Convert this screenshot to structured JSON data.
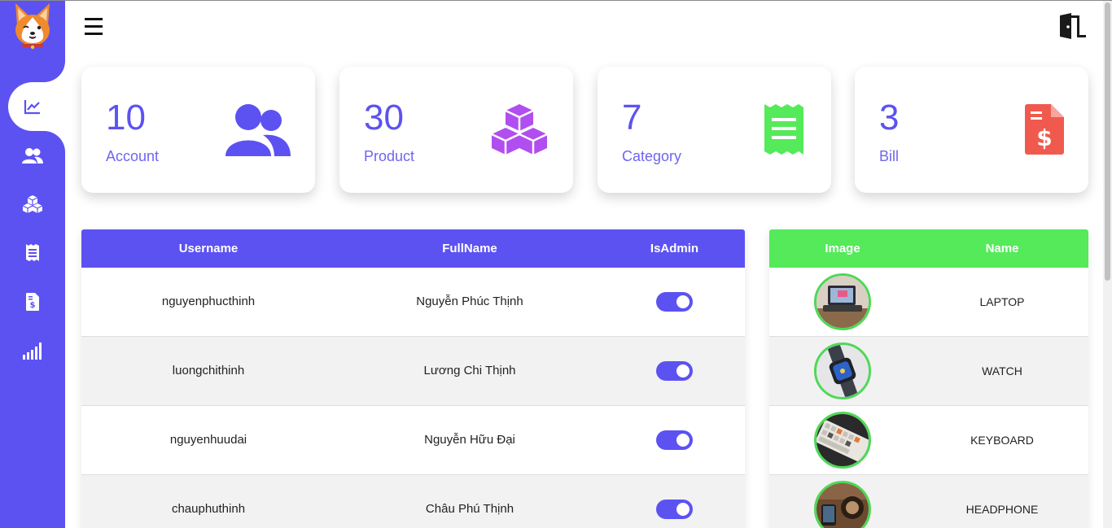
{
  "sidebar": {
    "logo_icon": "corgi-dog-logo",
    "items": [
      {
        "icon": "chart-line-icon",
        "active": true
      },
      {
        "icon": "users-icon",
        "active": false
      },
      {
        "icon": "cubes-icon",
        "active": false
      },
      {
        "icon": "receipt-icon",
        "active": false
      },
      {
        "icon": "invoice-dollar-icon",
        "active": false
      },
      {
        "icon": "signal-bars-icon",
        "active": false
      }
    ]
  },
  "topbar": {
    "menu_icon": "hamburger-menu-icon",
    "logout_icon": "door-exit-icon"
  },
  "stats": [
    {
      "value": "10",
      "label": "Account",
      "icon": "users-icon",
      "color": "#5c52f2"
    },
    {
      "value": "30",
      "label": "Product",
      "icon": "cubes-icon",
      "color": "#b04ef0"
    },
    {
      "value": "7",
      "label": "Category",
      "icon": "receipt-icon",
      "color": "#54ea5a"
    },
    {
      "value": "3",
      "label": "Bill",
      "icon": "invoice-dollar-icon",
      "color": "#f05a4e"
    }
  ],
  "users_table": {
    "headers": [
      "Username",
      "FullName",
      "IsAdmin"
    ],
    "rows": [
      {
        "username": "nguyenphucthinh",
        "fullname": "Nguyễn Phúc Thịnh",
        "is_admin": true
      },
      {
        "username": "luongchithinh",
        "fullname": "Lương Chi Thịnh",
        "is_admin": true
      },
      {
        "username": "nguyenhuudai",
        "fullname": "Nguyễn Hữu Đại",
        "is_admin": true
      },
      {
        "username": "chauphuthinh",
        "fullname": "Châu Phú Thịnh",
        "is_admin": true
      }
    ]
  },
  "products_table": {
    "headers": [
      "Image",
      "Name"
    ],
    "rows": [
      {
        "image": "laptop-photo",
        "name": "LAPTOP"
      },
      {
        "image": "watch-photo",
        "name": "WATCH"
      },
      {
        "image": "keyboard-photo",
        "name": "KEYBOARD"
      },
      {
        "image": "headphone-photo",
        "name": "HEADPHONE"
      }
    ]
  },
  "colors": {
    "primary": "#5c52f2",
    "green": "#54ea5a",
    "purple": "#b04ef0",
    "red": "#f05a4e"
  }
}
